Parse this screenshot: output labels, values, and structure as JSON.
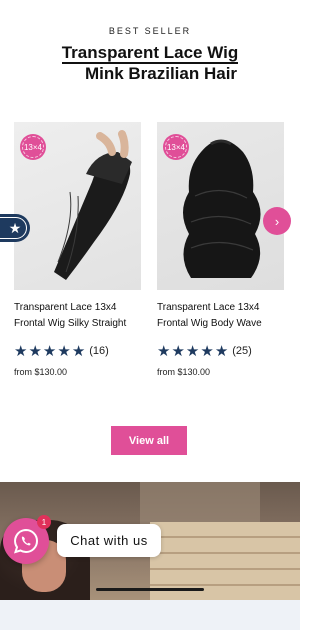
{
  "section": {
    "kicker": "BEST SELLER",
    "title_line1": "Transparent Lace Wig",
    "title_line2": "Mink Brazilian Hair"
  },
  "products": [
    {
      "badge": "13×4",
      "name": "Transparent Lace 13x4 Frontal Wig Silky Straight",
      "stars": 5,
      "review_count": "(16)",
      "price": "from $130.00"
    },
    {
      "badge": "13×4",
      "name": "Transparent Lace 13x4 Frontal Wig Body Wave",
      "stars": 5,
      "review_count": "(25)",
      "price": "from $130.00"
    }
  ],
  "carousel": {
    "prev_icon": "star-icon",
    "next_icon": "chevron-right-icon",
    "next_glyph": "›",
    "prev_glyph": "★"
  },
  "view_all_label": "View all",
  "chat": {
    "icon": "whatsapp-icon",
    "unread_count": "1",
    "label": "Chat with us"
  },
  "colors": {
    "accent": "#e04f98",
    "star": "#1e3a5f"
  }
}
